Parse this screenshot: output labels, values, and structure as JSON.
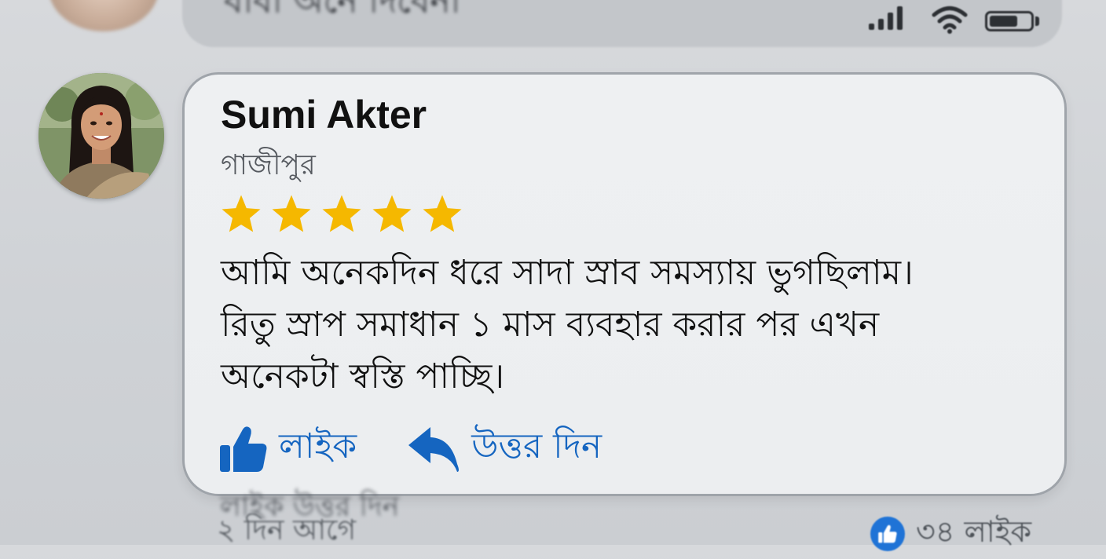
{
  "background": {
    "top_text": "বাবা অনে দিবেনা",
    "bottom_actions": "লাইক   উত্তর দিন",
    "time_ago": "২ দিন আগে",
    "like_count": "৩৪ লাইক"
  },
  "status_bar": {
    "icons": [
      "signal-icon",
      "wifi-icon",
      "battery-icon"
    ]
  },
  "comment": {
    "author": {
      "name": "Sumi Akter",
      "location": "গাজীপুর"
    },
    "rating": {
      "stars": 5,
      "max": 5,
      "color": "#f5b800"
    },
    "text_lines": [
      "আমি অনেকদিন ধরে সাদা স্রাব সমস্যায় ভুগছিলাম।",
      "রিতু স্রাপ সমাধান ১ মাস ব্যবহার করার পর এখন",
      "অনেকটা স্বস্তি পাচ্ছি।"
    ],
    "actions": {
      "like_label": "লাইক",
      "reply_label": "উত্তর দিন"
    }
  },
  "colors": {
    "accent": "#1565c0",
    "like_badge": "#1f73d6"
  }
}
